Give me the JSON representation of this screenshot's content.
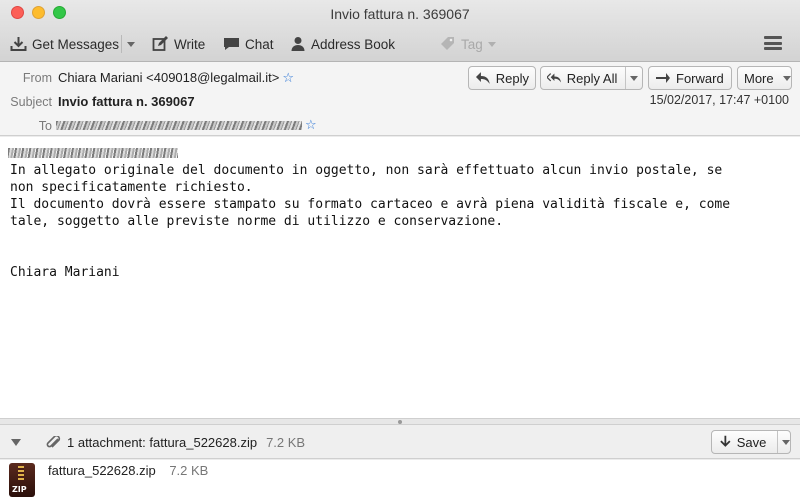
{
  "window": {
    "title": "Invio fattura n. 369067"
  },
  "toolbar": {
    "get_messages": "Get Messages",
    "write": "Write",
    "chat": "Chat",
    "address_book": "Address Book",
    "tag": "Tag"
  },
  "message": {
    "from_label": "From",
    "from_value": "Chiara Mariani <409018@legalmail.it>",
    "subject_label": "Subject",
    "subject_value": "Invio fattura n. 369067",
    "to_label": "To",
    "date": "15/02/2017, 17:47 +0100",
    "actions": {
      "reply": "Reply",
      "reply_all": "Reply All",
      "forward": "Forward",
      "more": "More"
    },
    "body_lines": [
      "In allegato originale del documento in oggetto, non sarà effettuato alcun invio postale, se",
      "non specificatamente richiesto.",
      "Il documento dovrà essere stampato su formato cartaceo e avrà piena validità fiscale e, come",
      "tale, soggetto alle previste norme di utilizzo e conservazione."
    ],
    "signature": "Chiara Mariani"
  },
  "attachments": {
    "summary": "1 attachment: fattura_522628.zip",
    "summary_size": "7.2 KB",
    "save_label": "Save",
    "items": [
      {
        "name": "fattura_522628.zip",
        "size": "7.2 KB",
        "icon": "zip-archive-icon"
      }
    ]
  },
  "colors": {
    "star": "#2a74d6",
    "close": "#fc5f57",
    "minimize": "#fdbc2e",
    "maximize": "#33c748"
  }
}
